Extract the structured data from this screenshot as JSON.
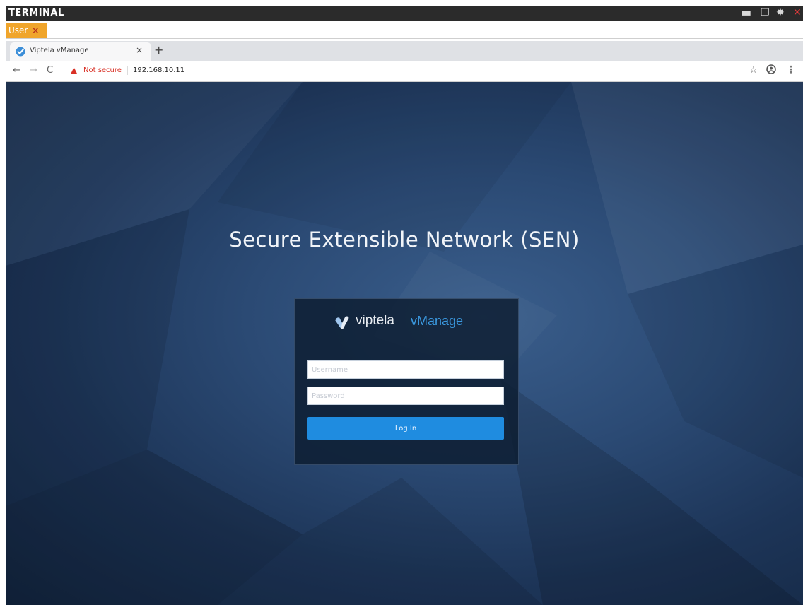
{
  "terminal": {
    "title": "TERMINAL",
    "minimize_glyph": "▬",
    "restore_glyph": "❐",
    "gear_glyph": "✸",
    "close_glyph": "✕"
  },
  "session_tab": {
    "label": "User",
    "close_glyph": "×"
  },
  "browser": {
    "tab_title": "Viptela vManage",
    "tab_close_glyph": "×",
    "new_tab_glyph": "+",
    "back_glyph": "←",
    "forward_glyph": "→",
    "reload_glyph": "C",
    "warning_glyph": "▲",
    "security_label": "Not secure",
    "separator": "|",
    "url": "192.168.10.11",
    "star_glyph": "☆",
    "menu_glyph": "⋮"
  },
  "page": {
    "heading": "Secure Extensible Network (SEN)",
    "brand_name": "viptela",
    "brand_product": "vManage",
    "username_placeholder": "Username",
    "password_placeholder": "Password",
    "login_label": "Log In"
  },
  "colors": {
    "brand_blue": "#3b9ae1",
    "login_button": "#1f8ce0",
    "session_tab": "#f0a52b",
    "warning_red": "#d93025"
  }
}
